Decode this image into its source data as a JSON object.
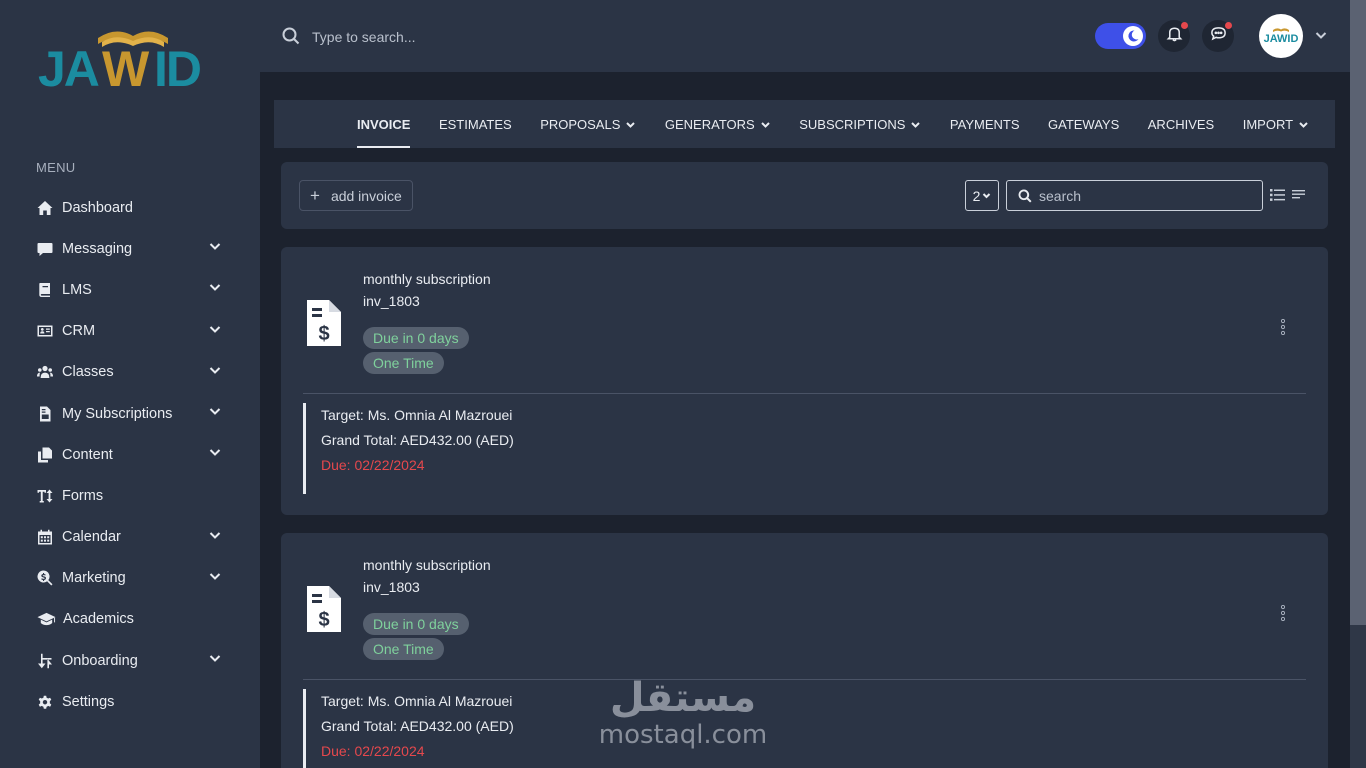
{
  "app": {
    "logo_text": "JAWID"
  },
  "sidebar": {
    "menu_title": "MENU",
    "items": [
      {
        "label": "Dashboard",
        "icon": "home-icon",
        "has_submenu": false
      },
      {
        "label": "Messaging",
        "icon": "chat-icon",
        "has_submenu": true
      },
      {
        "label": "LMS",
        "icon": "book-icon",
        "has_submenu": true
      },
      {
        "label": "CRM",
        "icon": "address-card-icon",
        "has_submenu": true
      },
      {
        "label": "Classes",
        "icon": "users-icon",
        "has_submenu": true
      },
      {
        "label": "My Subscriptions",
        "icon": "file-invoice-icon",
        "has_submenu": true
      },
      {
        "label": "Content",
        "icon": "copy-icon",
        "has_submenu": true
      },
      {
        "label": "Forms",
        "icon": "text-height-icon",
        "has_submenu": false
      },
      {
        "label": "Calendar",
        "icon": "calendar-icon",
        "has_submenu": true
      },
      {
        "label": "Marketing",
        "icon": "search-dollar-icon",
        "has_submenu": true
      },
      {
        "label": "Academics",
        "icon": "graduation-cap-icon",
        "has_submenu": false
      },
      {
        "label": "Onboarding",
        "icon": "exchange-icon",
        "has_submenu": true
      },
      {
        "label": "Settings",
        "icon": "gear-icon",
        "has_submenu": false
      }
    ]
  },
  "header": {
    "search_placeholder": "Type to search...",
    "dark_mode": true,
    "notifications_unread": true,
    "messages_unread": true,
    "avatar_text": "JAWID"
  },
  "tabs": [
    {
      "label": "INVOICE",
      "active": true,
      "dropdown": false
    },
    {
      "label": "ESTIMATES",
      "active": false,
      "dropdown": false
    },
    {
      "label": "PROPOSALS",
      "active": false,
      "dropdown": true
    },
    {
      "label": "GENERATORS",
      "active": false,
      "dropdown": true
    },
    {
      "label": "SUBSCRIPTIONS",
      "active": false,
      "dropdown": true
    },
    {
      "label": "PAYMENTS",
      "active": false,
      "dropdown": false
    },
    {
      "label": "GATEWAYS",
      "active": false,
      "dropdown": false
    },
    {
      "label": "ARCHIVES",
      "active": false,
      "dropdown": false
    },
    {
      "label": "IMPORT",
      "active": false,
      "dropdown": true
    }
  ],
  "toolbar": {
    "add_label": "add invoice",
    "per_page": "2",
    "search_placeholder": "search"
  },
  "invoices": [
    {
      "name": "monthly subscription",
      "id": "inv_1803",
      "due_badge": "Due in 0 days",
      "type_badge": "One Time",
      "target": "Target: Ms. Omnia Al Mazrouei",
      "grand_total": "Grand Total: AED432.00 (AED)",
      "due": "Due: 02/22/2024"
    },
    {
      "name": "monthly subscription",
      "id": "inv_1803",
      "due_badge": "Due in 0 days",
      "type_badge": "One Time",
      "target": "Target: Ms. Omnia Al Mazrouei",
      "grand_total": "Grand Total: AED432.00 (AED)",
      "due": "Due: 02/22/2024"
    }
  ],
  "watermark": {
    "arabic": "مستقل",
    "latin": "mostaql.com"
  },
  "colors": {
    "sidebar_bg": "#2b3445",
    "page_bg": "#1c222e",
    "accent_toggle": "#3e50e8",
    "badge_text": "#7fd19c",
    "due_text": "#e5484d",
    "notification_dot": "#e5484d"
  }
}
